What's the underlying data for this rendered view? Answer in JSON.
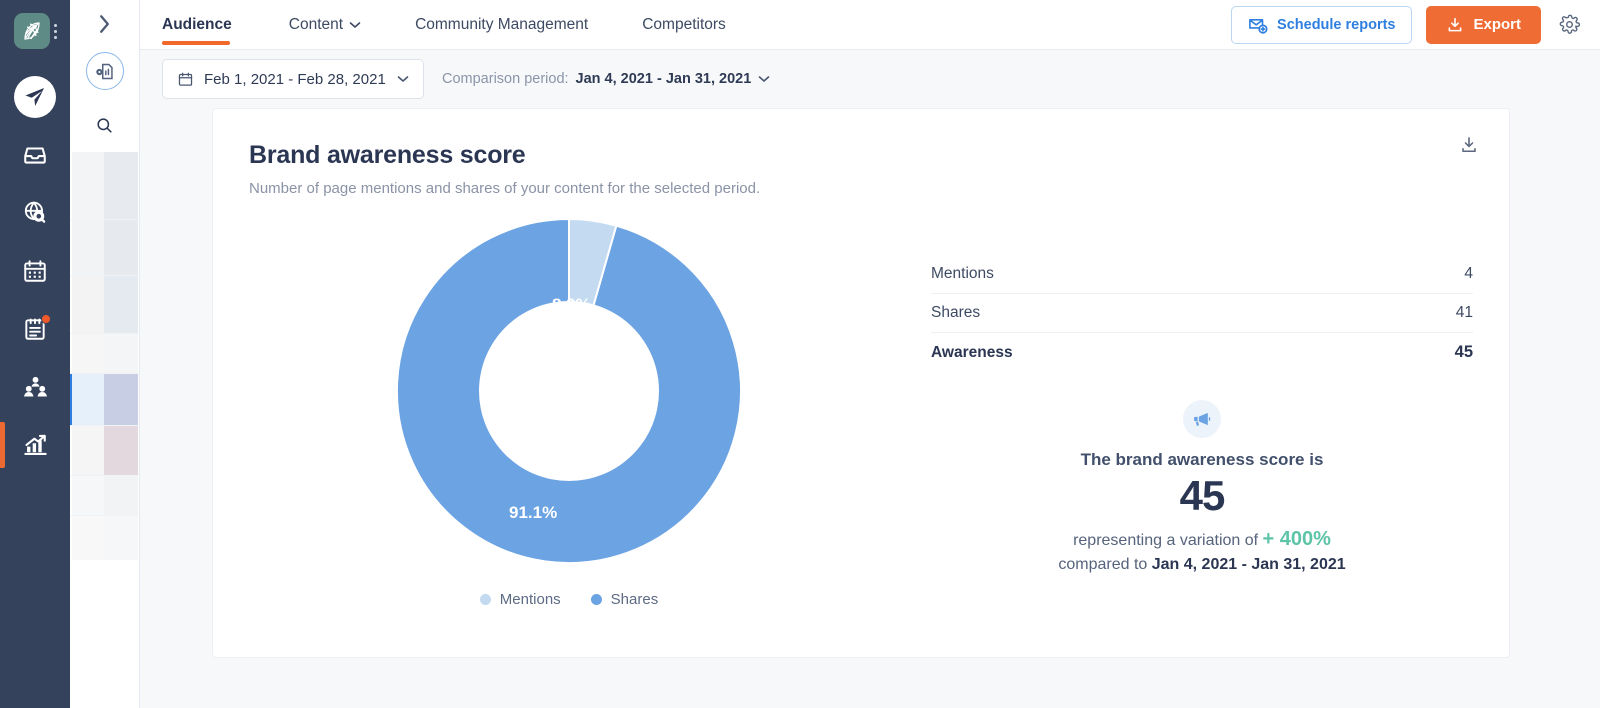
{
  "sidebar": {
    "logo": {
      "icon": "leaf-globe-logo-icon",
      "menu_icon": "kebab-menu-icon"
    },
    "items": [
      {
        "icon": "paper-plane-publish-icon",
        "name": "publish",
        "active": false,
        "badge": false
      },
      {
        "icon": "inbox-tray-icon",
        "name": "inbox",
        "active": false,
        "badge": false
      },
      {
        "icon": "globe-search-listening-icon",
        "name": "listening",
        "active": false,
        "badge": false
      },
      {
        "icon": "calendar-icon",
        "name": "calendar",
        "active": false,
        "badge": false
      },
      {
        "icon": "clipboard-tasks-icon",
        "name": "tasks",
        "active": false,
        "badge": true
      },
      {
        "icon": "community-people-icon",
        "name": "community",
        "active": false,
        "badge": false
      },
      {
        "icon": "analytics-bar-chart-icon",
        "name": "analytics",
        "active": true,
        "badge": false
      }
    ]
  },
  "panel": {
    "expand_icon": "chevron-right-icon",
    "report_icon": "report-document-icon",
    "search_icon": "search-icon"
  },
  "header": {
    "tabs": [
      {
        "label": "Audience",
        "active": true,
        "dropdown": false
      },
      {
        "label": "Content",
        "active": false,
        "dropdown": true
      },
      {
        "label": "Community Management",
        "active": false,
        "dropdown": false
      },
      {
        "label": "Competitors",
        "active": false,
        "dropdown": false
      }
    ],
    "schedule_label": "Schedule reports",
    "schedule_icon": "mail-add-icon",
    "export_label": "Export",
    "export_icon": "download-icon",
    "settings_icon": "gear-icon",
    "accent_orange": "#ef6c34",
    "accent_blue": "#2f7fe0"
  },
  "filters": {
    "calendar_icon": "calendar-icon",
    "date_range": "Feb 1, 2021 - Feb 28, 2021",
    "chevron_icon": "chevron-down-icon",
    "comparison_label": "Comparison period:",
    "comparison_range": "Jan 4, 2021 - Jan 31, 2021"
  },
  "card": {
    "title": "Brand awareness score",
    "subtitle": "Number of page mentions and shares of your content for the selected period.",
    "download_icon": "download-icon",
    "stats": [
      {
        "label": "Mentions",
        "value": "4",
        "total": false
      },
      {
        "label": "Shares",
        "value": "41",
        "total": false
      },
      {
        "label": "Awareness",
        "value": "45",
        "total": true
      }
    ],
    "summary": {
      "icon": "megaphone-icon",
      "line1": "The brand awareness score is",
      "score": "45",
      "line3_prefix": "representing a variation of",
      "variation": "+ 400%",
      "variation_color": "#5ec4a8",
      "line4_prefix": "compared to",
      "line4_range": "Jan 4, 2021 - Jan 31, 2021"
    }
  },
  "chart_data": {
    "type": "pie",
    "title": "Brand awareness score",
    "subtitle": "Number of page mentions and shares of your content for the selected period.",
    "donut": true,
    "categories": [
      "Mentions",
      "Shares"
    ],
    "values": [
      4,
      41
    ],
    "percentages": [
      "8.9%",
      "91.1%"
    ],
    "colors": [
      "#c3daf1",
      "#6ba3e3"
    ],
    "legend_position": "bottom",
    "start_angle_deg": 0,
    "labels": {
      "mentions": "8.9%",
      "shares": "91.1%"
    },
    "total": 45
  }
}
